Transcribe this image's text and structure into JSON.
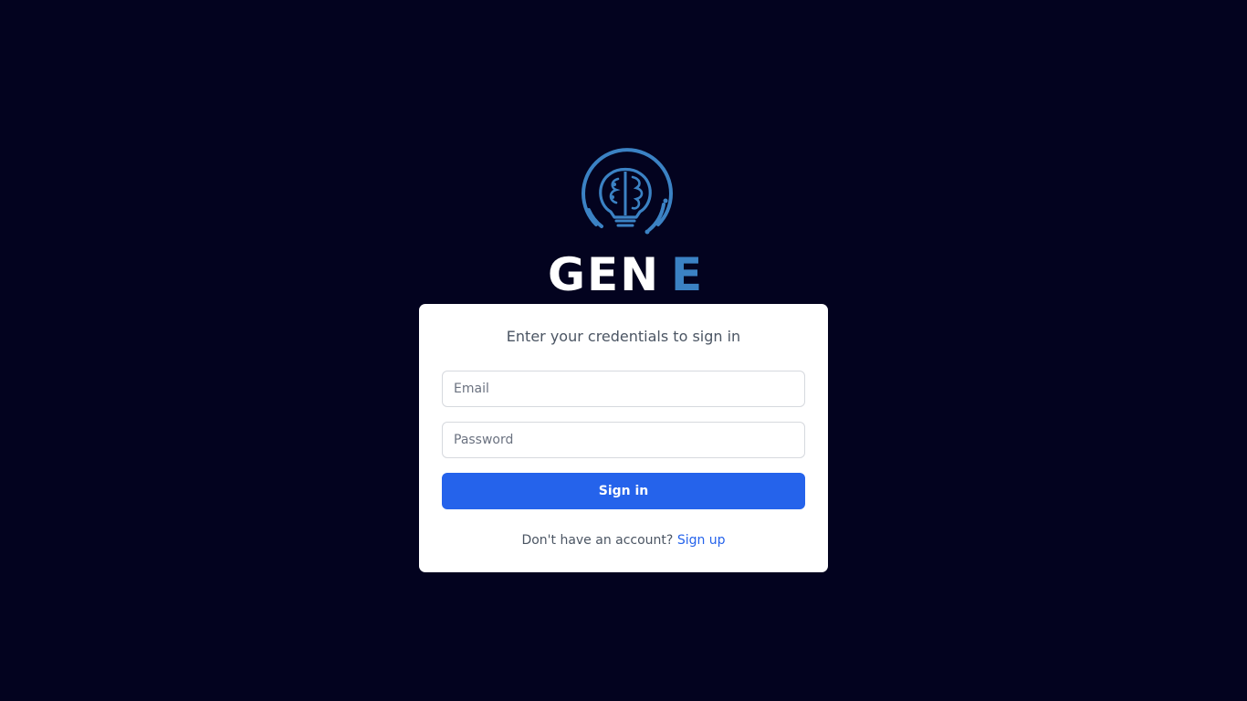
{
  "brand": {
    "name_part1": "GEN",
    "name_part2": "E",
    "logo_icon": "brain-lightbulb-icon",
    "colors": {
      "background": "#03031f",
      "accent": "#3b82c4",
      "primary": "#2563eb"
    }
  },
  "login": {
    "subtitle": "Enter your credentials to sign in",
    "email_placeholder": "Email",
    "password_placeholder": "Password",
    "submit_label": "Sign in",
    "no_account_text": "Don't have an account?",
    "signup_link": "Sign up"
  }
}
